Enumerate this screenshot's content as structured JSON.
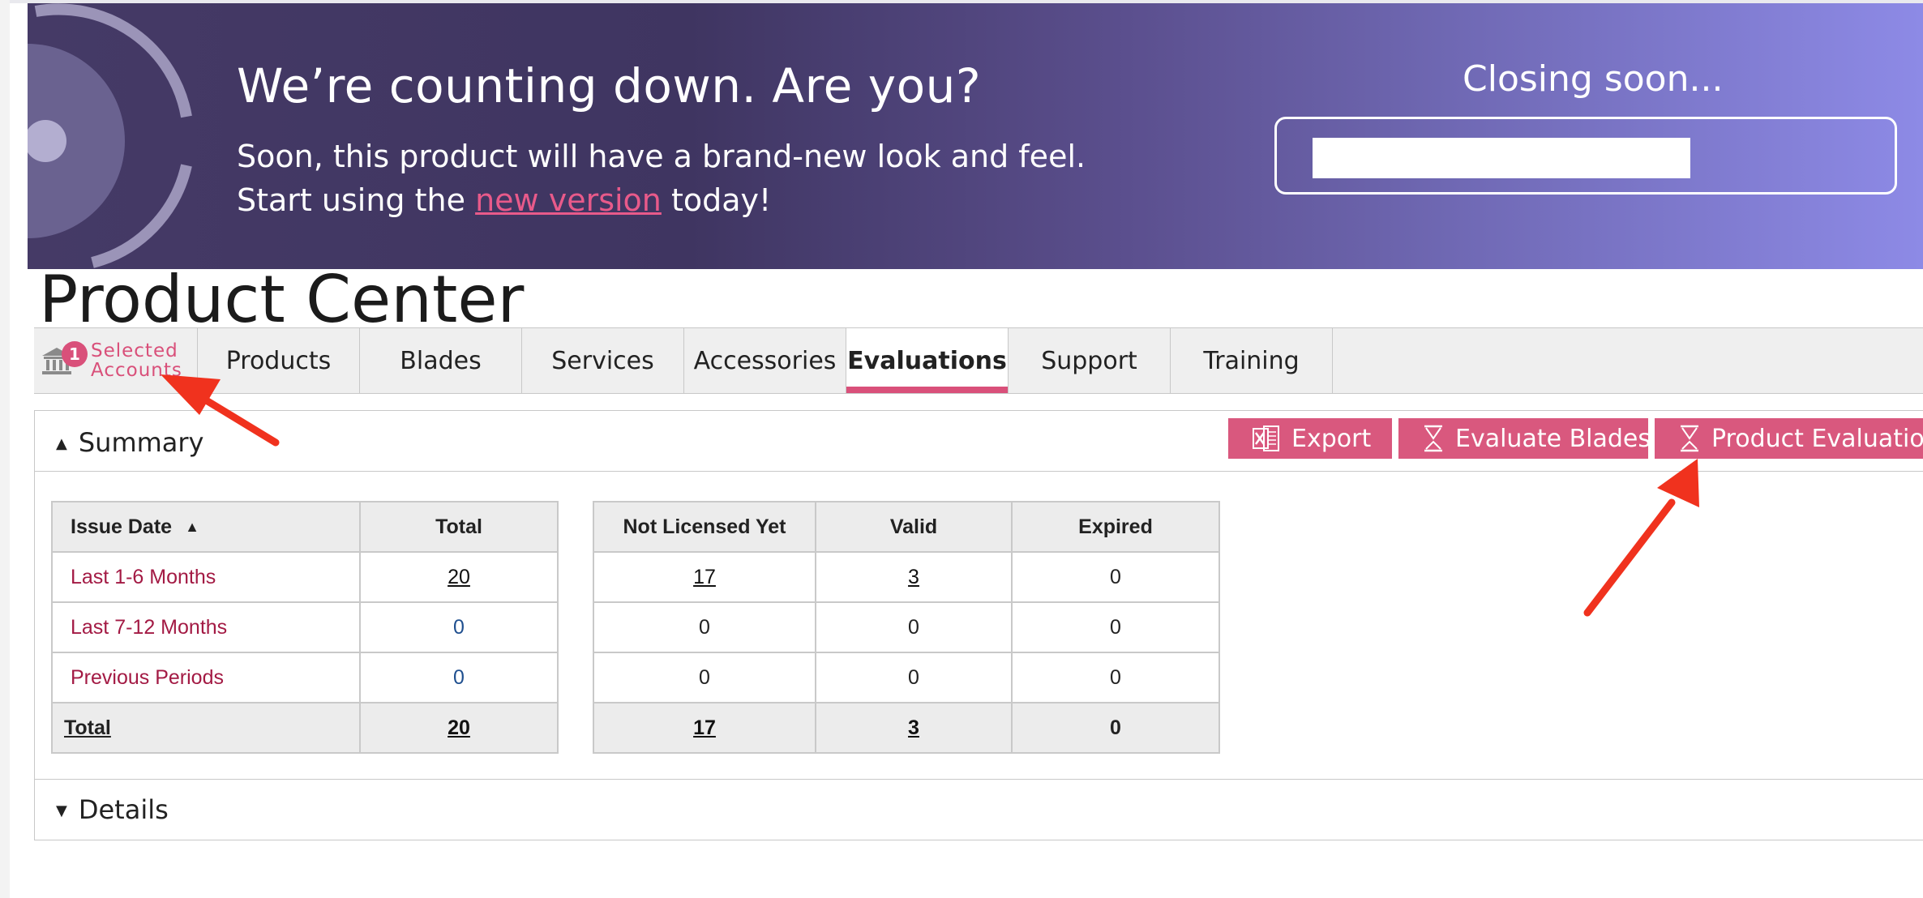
{
  "banner": {
    "title": "We’re counting down. Are you?",
    "line1": "Soon, this product will have a brand-new look and feel.",
    "line2_prefix": "Start using the ",
    "line2_link": "new version",
    "line2_suffix": " today!",
    "closing_label": "Closing soon..."
  },
  "page_title": "Product Center",
  "tabs": {
    "account_badge": "1",
    "account_label_1": "Selected",
    "account_label_2": "Accounts",
    "items": [
      "Products",
      "Blades",
      "Services",
      "Accessories",
      "Evaluations",
      "Support",
      "Training"
    ],
    "active": "Evaluations"
  },
  "summary": {
    "title": "Summary",
    "buttons": {
      "export": "Export",
      "evaluate_blades": "Evaluate Blades",
      "product_evaluation": "Product Evaluation"
    },
    "table1": {
      "headers": [
        "Issue Date",
        "Total"
      ],
      "rows": [
        {
          "label": "Last 1-6 Months",
          "total": "20"
        },
        {
          "label": "Last 7-12 Months",
          "total": "0"
        },
        {
          "label": "Previous Periods",
          "total": "0"
        }
      ],
      "total_row": {
        "label": "Total",
        "total": "20"
      }
    },
    "table2": {
      "headers": [
        "Not Licensed Yet",
        "Valid",
        "Expired"
      ],
      "rows": [
        [
          "17",
          "3",
          "0"
        ],
        [
          "0",
          "0",
          "0"
        ],
        [
          "0",
          "0",
          "0"
        ]
      ],
      "total_row": [
        "17",
        "3",
        "0"
      ]
    }
  },
  "details": {
    "title": "Details"
  },
  "colors": {
    "accent": "#d9587e",
    "banner_dark": "#3f3561",
    "banner_light": "#8d8ae6",
    "link_red": "#a31a44",
    "annotation_arrow": "#f0321e"
  }
}
